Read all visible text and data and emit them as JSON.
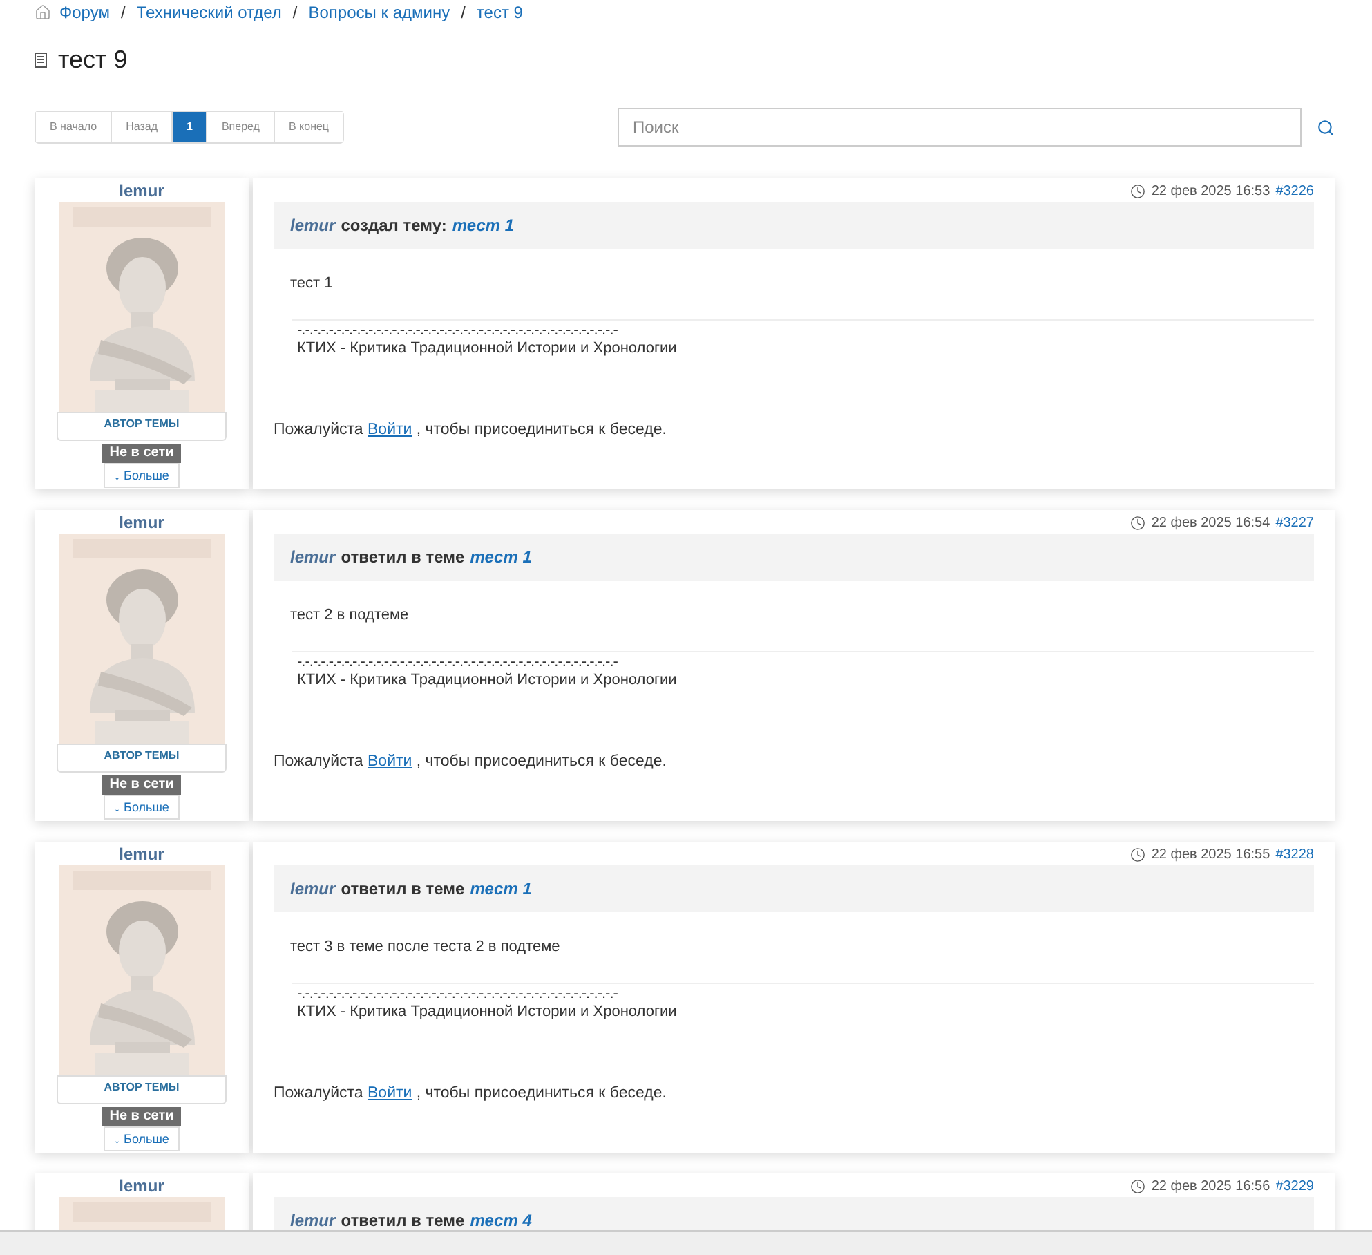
{
  "breadcrumb": [
    {
      "label": "Форум"
    },
    {
      "separator": "/",
      "label": "Технический отдел"
    },
    {
      "separator": "/",
      "label": "Вопросы к админу"
    },
    {
      "separator": "/",
      "label": "тест 9"
    }
  ],
  "title": "тест 9",
  "pagination": [
    {
      "label": "В начало",
      "selected": false
    },
    {
      "label": "Назад",
      "selected": false
    },
    {
      "label": "1",
      "selected": true
    },
    {
      "label": "Вперед",
      "selected": false
    },
    {
      "label": "В конец",
      "selected": false
    }
  ],
  "search": {
    "placeholder": "Поиск"
  },
  "posts": [
    {
      "user": "lemur",
      "role": "АВТОР ТЕМЫ",
      "status": "Не в сети",
      "more": "↓ Больше",
      "date": "22 фев 2025 16:53",
      "number": "#3226",
      "author": "lemur",
      "action": "создал тему:",
      "topic": "тест 1",
      "body": "тест 1",
      "signature_rule": "-.-.-.-.-.-.-.-.-.-.-.-.-.-.-.-.-.-.-.-.-.-.-.-.-.-.-.-.-.-.-.-.-.-.-.-.-.-.-.-.-",
      "signature": "КТИХ - Критика Традиционной Истории и Хронологии",
      "login_prefix": "Пожалуйста",
      "login_link": "Войти",
      "login_suffix": ", чтобы присоединиться к беседе."
    },
    {
      "user": "lemur",
      "role": "АВТОР ТЕМЫ",
      "status": "Не в сети",
      "more": "↓ Больше",
      "date": "22 фев 2025 16:54",
      "number": "#3227",
      "author": "lemur",
      "action": "ответил в теме",
      "topic": "тест 1",
      "body": "тест 2 в подтеме",
      "signature_rule": "-.-.-.-.-.-.-.-.-.-.-.-.-.-.-.-.-.-.-.-.-.-.-.-.-.-.-.-.-.-.-.-.-.-.-.-.-.-.-.-.-",
      "signature": "КТИХ - Критика Традиционной Истории и Хронологии",
      "login_prefix": "Пожалуйста",
      "login_link": "Войти",
      "login_suffix": ", чтобы присоединиться к беседе."
    },
    {
      "user": "lemur",
      "role": "АВТОР ТЕМЫ",
      "status": "Не в сети",
      "more": "↓ Больше",
      "date": "22 фев 2025 16:55",
      "number": "#3228",
      "author": "lemur",
      "action": "ответил в теме",
      "topic": "тест 1",
      "body": "тест 3 в теме после теста 2 в подтеме",
      "signature_rule": "-.-.-.-.-.-.-.-.-.-.-.-.-.-.-.-.-.-.-.-.-.-.-.-.-.-.-.-.-.-.-.-.-.-.-.-.-.-.-.-.-",
      "signature": "КТИХ - Критика Традиционной Истории и Хронологии",
      "login_prefix": "Пожалуйста",
      "login_link": "Войти",
      "login_suffix": ", чтобы присоединиться к беседе."
    },
    {
      "user": "lemur",
      "date": "22 фев 2025 16:56",
      "number": "#3229",
      "author": "lemur",
      "action": "ответил в теме",
      "topic": "тест 4"
    }
  ]
}
